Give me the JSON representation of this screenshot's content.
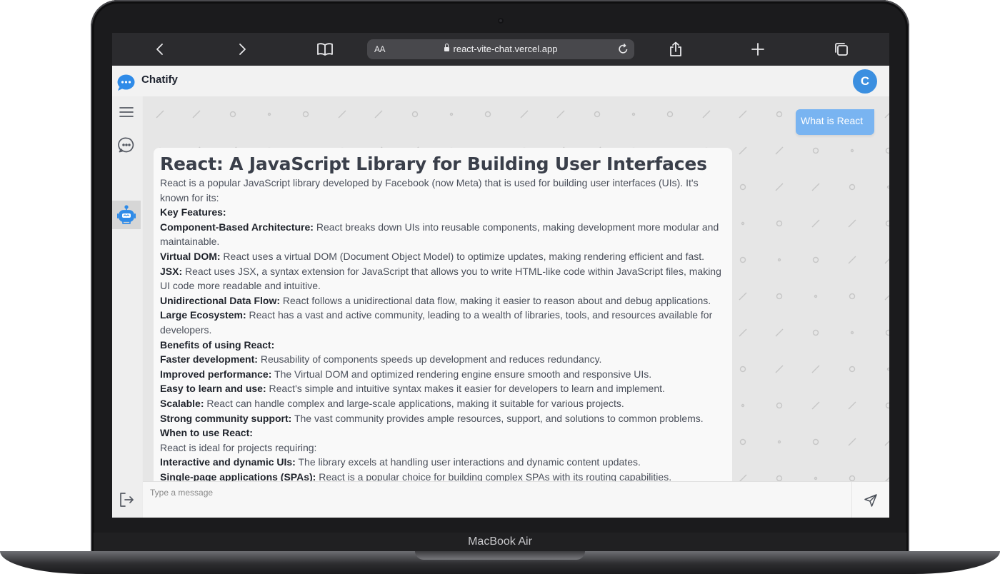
{
  "device": {
    "label": "MacBook Air"
  },
  "browser": {
    "text_size_label": "AA",
    "url": "react-vite-chat.vercel.app",
    "icons": [
      "back-icon",
      "forward-icon",
      "bookmarks-icon",
      "reload-icon",
      "share-icon",
      "new-tab-icon",
      "tabs-icon"
    ]
  },
  "app": {
    "name": "Chatify",
    "avatar_initial": "C",
    "accent_color": "#3b8fe0"
  },
  "sidebar": {
    "items": [
      {
        "name": "menu",
        "icon": "hamburger-icon"
      },
      {
        "name": "chats",
        "icon": "chat-bubble-icon"
      },
      {
        "name": "bot",
        "icon": "robot-icon",
        "active": true
      },
      {
        "name": "logout",
        "icon": "logout-icon"
      }
    ]
  },
  "conversation": {
    "user_message": "What is React",
    "bot_message": {
      "title": "React: A JavaScript Library for Building User Interfaces",
      "lines": [
        {
          "bold": "",
          "text": "React is a popular JavaScript library developed by Facebook (now Meta) that is used for building user interfaces (UIs). It's known for its:"
        },
        {
          "bold": "Key Features:",
          "text": ""
        },
        {
          "bold": "Component-Based Architecture:",
          "text": " React breaks down UIs into reusable components, making development more modular and maintainable."
        },
        {
          "bold": "Virtual DOM:",
          "text": " React uses a virtual DOM (Document Object Model) to optimize updates, making rendering efficient and fast."
        },
        {
          "bold": "JSX:",
          "text": " React uses JSX, a syntax extension for JavaScript that allows you to write HTML-like code within JavaScript files, making UI code more readable and intuitive."
        },
        {
          "bold": "Unidirectional Data Flow:",
          "text": " React follows a unidirectional data flow, making it easier to reason about and debug applications."
        },
        {
          "bold": "Large Ecosystem:",
          "text": " React has a vast and active community, leading to a wealth of libraries, tools, and resources available for developers."
        },
        {
          "bold": "Benefits of using React:",
          "text": ""
        },
        {
          "bold": "Faster development:",
          "text": " Reusability of components speeds up development and reduces redundancy."
        },
        {
          "bold": "Improved performance:",
          "text": " The Virtual DOM and optimized rendering engine ensure smooth and responsive UIs."
        },
        {
          "bold": "Easy to learn and use:",
          "text": " React's simple and intuitive syntax makes it easier for developers to learn and implement."
        },
        {
          "bold": "Scalable:",
          "text": " React can handle complex and large-scale applications, making it suitable for various projects."
        },
        {
          "bold": "Strong community support:",
          "text": " The vast community provides ample resources, support, and solutions to common problems."
        },
        {
          "bold": "When to use React:",
          "text": ""
        },
        {
          "bold": "",
          "text": "React is ideal for projects requiring:"
        },
        {
          "bold": "Interactive and dynamic UIs:",
          "text": " The library excels at handling user interactions and dynamic content updates."
        },
        {
          "bold": "Single-page applications (SPAs):",
          "text": " React is a popular choice for building complex SPAs with its routing capabilities."
        }
      ]
    }
  },
  "composer": {
    "placeholder": "Type a message",
    "value": ""
  }
}
